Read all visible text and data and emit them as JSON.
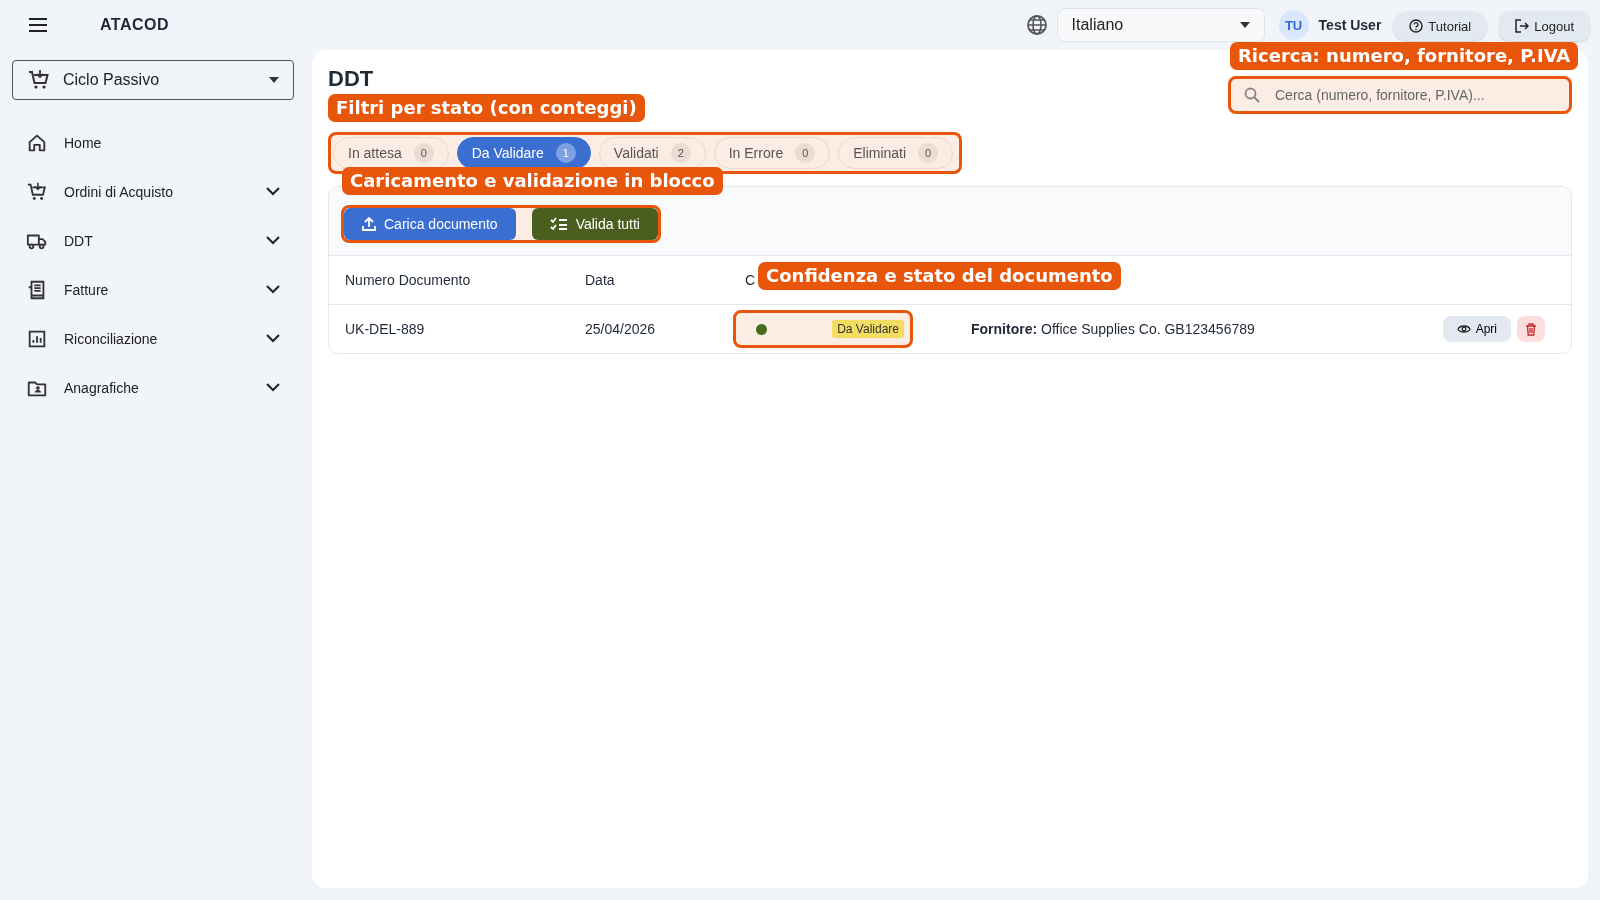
{
  "app": {
    "title": "ATACOD"
  },
  "topbar": {
    "language": "Italiano",
    "user": {
      "initials": "TU",
      "name": "Test User"
    },
    "buttons": [
      {
        "label": "Tutorial",
        "kind": "help"
      },
      {
        "label": "Logout",
        "kind": "logout"
      }
    ]
  },
  "sidebar": {
    "module": "Ciclo Passivo",
    "items": [
      {
        "label": "Home",
        "expandable": false
      },
      {
        "label": "Ordini di Acquisto",
        "expandable": true
      },
      {
        "label": "DDT",
        "expandable": true
      },
      {
        "label": "Fatture",
        "expandable": true
      },
      {
        "label": "Riconciliazione",
        "expandable": true
      },
      {
        "label": "Anagrafiche",
        "expandable": true
      }
    ]
  },
  "page": {
    "title": "DDT",
    "search": {
      "placeholder": "Cerca (numero, fornitore, P.IVA)..."
    },
    "tabs": [
      {
        "label": "In attesa",
        "count": "0",
        "selected": false
      },
      {
        "label": "Da Validare",
        "count": "1",
        "selected": true
      },
      {
        "label": "Validati",
        "count": "2",
        "selected": false
      },
      {
        "label": "In Errore",
        "count": "0",
        "selected": false
      },
      {
        "label": "Eliminati",
        "count": "0",
        "selected": false
      }
    ],
    "actions": [
      {
        "label": "Carica documento",
        "kind": "upload"
      },
      {
        "label": "Valida tutti",
        "kind": "validate"
      }
    ],
    "table": {
      "columns": [
        "Numero Documento",
        "Data",
        "C"
      ],
      "rows": [
        {
          "number": "UK-DEL-889",
          "date": "25/04/2026",
          "confidence": {
            "color": "#4a6b1f"
          },
          "status": "Da Validare",
          "supplier": "**Fornitore:** Office Supplies Co. GB123456789",
          "open": "Apri"
        }
      ]
    }
  },
  "tour": {
    "callouts": [
      {
        "text": "Ricerca: numero, fornitore, P.IVA"
      },
      {
        "text": "Filtri per stato (con conteggi)"
      },
      {
        "text": "Caricamento e validazione in blocco"
      },
      {
        "text": "Confidenza e stato del documento"
      }
    ]
  }
}
